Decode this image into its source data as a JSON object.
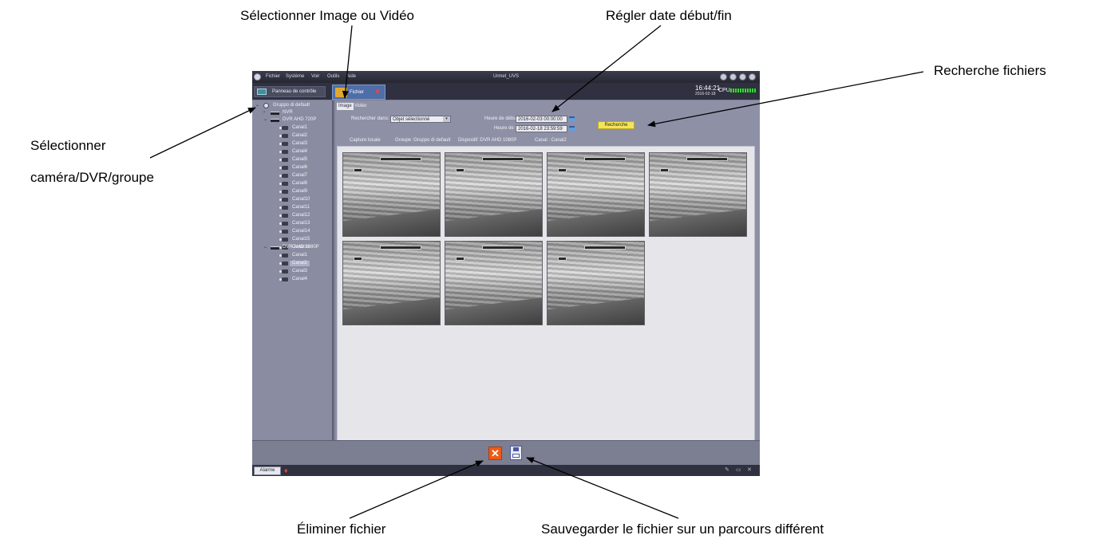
{
  "callouts": {
    "select_media": "Sélectionner Image ou Vidéo",
    "set_dates": "Régler date début/fin",
    "search_files": "Recherche fichiers",
    "select_device_line1": "Sélectionner",
    "select_device_line2": "caméra/DVR/groupe",
    "delete_file": "Éliminer fichier",
    "save_file": "Sauvegarder le fichier sur un parcours différent"
  },
  "app": {
    "title": "Urmet_UVS",
    "menu": [
      "Fichier",
      "Système",
      "Voir",
      "Outils",
      "Aide"
    ],
    "tabs": {
      "panel": "Panneau de contrôle",
      "files": "Fichier"
    },
    "clock": {
      "time": "16:44:21",
      "date": "2016-02-18"
    },
    "cpu_label": "CPU"
  },
  "tree": {
    "root": "Gruppo di default",
    "nvr": "NVR",
    "dvr720": "DVR AHD 720P",
    "dvr720_channels": [
      "Canal1",
      "Canal2",
      "Canal3",
      "Canal4",
      "Canal5",
      "Canal6",
      "Canal7",
      "Canal8",
      "Canal9",
      "Canal10",
      "Canal11",
      "Canal12",
      "Canal13",
      "Canal14",
      "Canal15",
      "Canal16"
    ],
    "dvr1080": "DVR AHD 1080P",
    "dvr1080_channels": [
      "Canal1",
      "Canal2",
      "Canal3",
      "Canal4"
    ],
    "selected": "DVR AHD 1080P / Canal2"
  },
  "search": {
    "tab_image": "Image",
    "tab_video": "Vidéo",
    "search_in_label": "Rechercher dans:",
    "search_in_value": "Objet sélectionné",
    "start_label": "Heure de début",
    "start_value": "2016-02-03 00:00:00",
    "end_label": "Heure de fin",
    "end_value": "2016-02-18 23:59:59",
    "button": "Recherche"
  },
  "info": {
    "capture": "Capture locale",
    "group": "Groupe :Gruppo di default",
    "device": "Dispositif :DVR AHD 1080P",
    "channel": "Canal :   Canal2"
  },
  "gallery": {
    "image_count": 7
  },
  "statusbar": {
    "alarm": "Alarme"
  }
}
